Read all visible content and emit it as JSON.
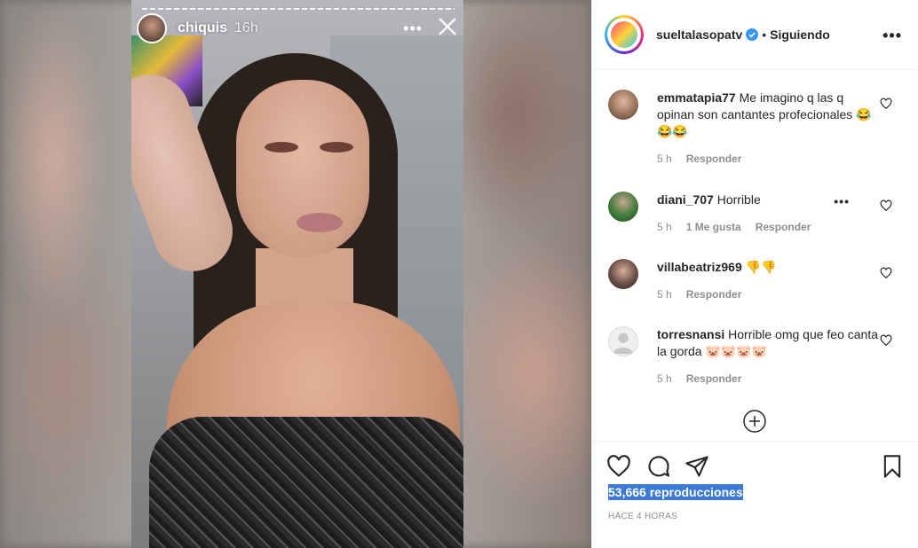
{
  "story": {
    "username": "chiquis",
    "time": "16h"
  },
  "post": {
    "account": "sueltalasopatv",
    "separator": "•",
    "follow_status": "Siguiendo"
  },
  "comments": [
    {
      "user": "emmatapia77",
      "text": "Me imagino q las q opinan son cantantes profecionales 😂😂😂",
      "time": "5 h",
      "likes": "",
      "reply": "Responder"
    },
    {
      "user": "diani_707",
      "text": "Horrible",
      "time": "5 h",
      "likes": "1 Me gusta",
      "reply": "Responder"
    },
    {
      "user": "villabeatriz969",
      "text": "👎👎",
      "time": "5 h",
      "likes": "",
      "reply": "Responder"
    },
    {
      "user": "torresnansi",
      "text": "Horrible omg que feo canta la gorda 🐷🐷🐷🐷",
      "time": "5 h",
      "likes": "",
      "reply": "Responder"
    }
  ],
  "stats": {
    "views": "53,666 reproducciones",
    "posted": "HACE 4 HORAS"
  },
  "colors": {
    "verified": "#3897f0",
    "highlight": "#3b7bd6",
    "muted": "#8e8e8e"
  }
}
